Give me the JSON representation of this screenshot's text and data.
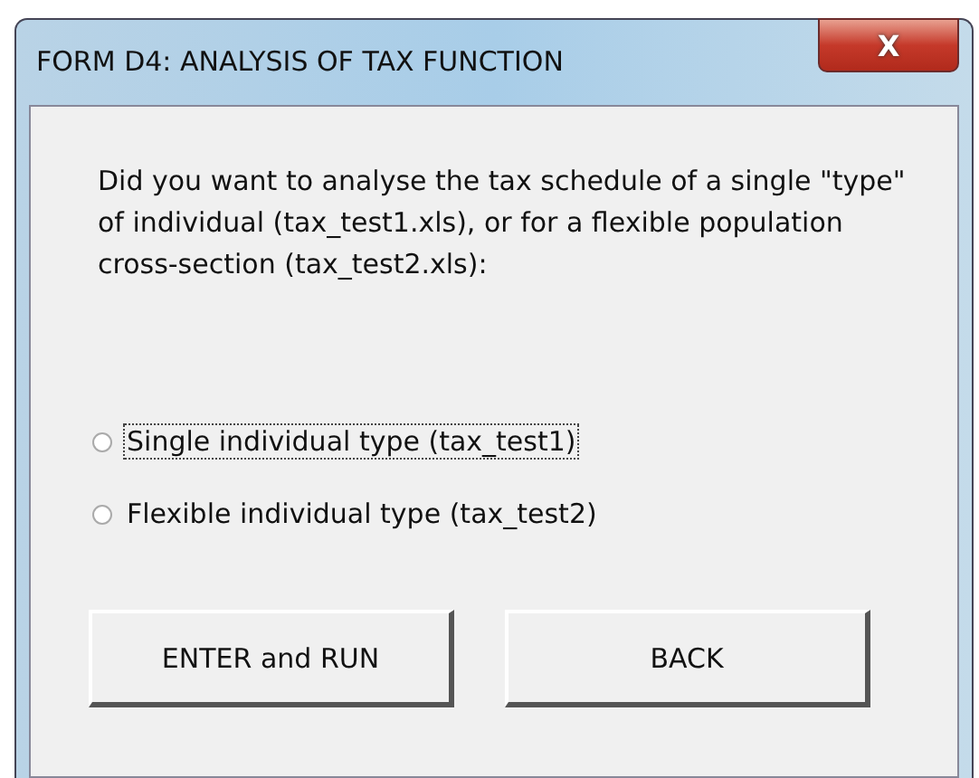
{
  "window": {
    "title": "FORM D4: ANALYSIS OF TAX FUNCTION",
    "close_label": "X"
  },
  "prompt": "Did you want to analyse the tax schedule of a single \"type\" of individual (tax_test1.xls), or for a flexible population cross-section (tax_test2.xls):",
  "options": [
    {
      "label": "Single individual type (tax_test1)",
      "selected": false,
      "focused": true
    },
    {
      "label": "Flexible individual type (tax_test2)",
      "selected": false,
      "focused": false
    }
  ],
  "buttons": [
    "ENTER and RUN",
    "BACK"
  ]
}
